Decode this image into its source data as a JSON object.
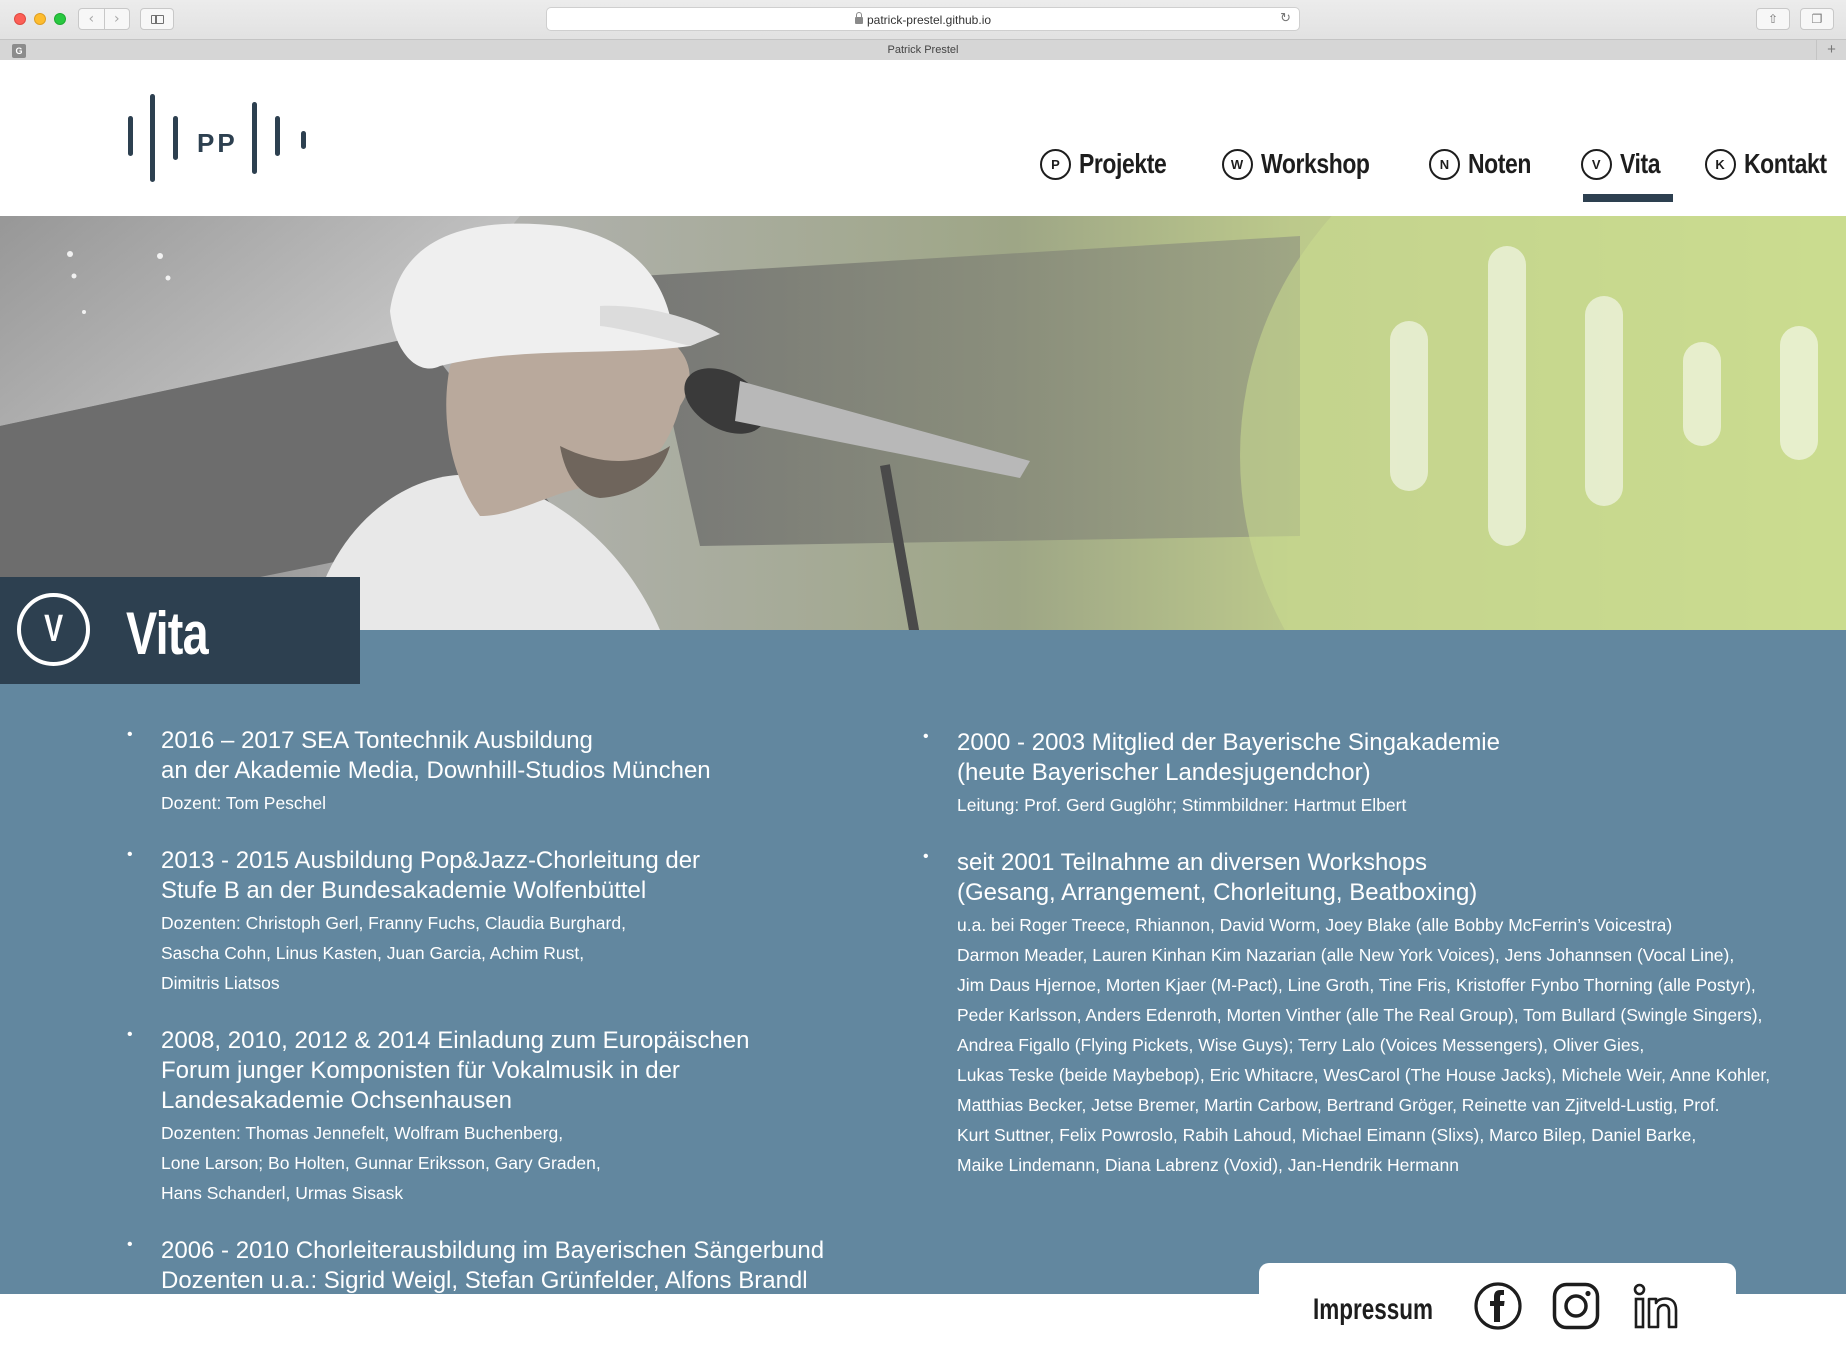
{
  "browser": {
    "url": "patrick-prestel.github.io",
    "tab_title": "Patrick Prestel",
    "tab_favicon_letter": "G"
  },
  "logo": {
    "letters": "PP"
  },
  "nav": {
    "items": [
      {
        "badge": "P",
        "label": "Projekte",
        "active": false
      },
      {
        "badge": "W",
        "label": "Workshop",
        "active": false
      },
      {
        "badge": "N",
        "label": "Noten",
        "active": false
      },
      {
        "badge": "V",
        "label": "Vita",
        "active": true
      },
      {
        "badge": "K",
        "label": "Kontakt",
        "active": false
      }
    ]
  },
  "section": {
    "badge": "V",
    "title": "Vita"
  },
  "vita": {
    "left": [
      {
        "title": "2016 – 2017 SEA Tontechnik Ausbildung\nan der Akademie Media, Downhill-Studios München",
        "detail": "Dozent: Tom Peschel"
      },
      {
        "title": "2013 - 2015 Ausbildung Pop&Jazz-Chorleitung der\nStufe B an der Bundesakademie Wolfenbüttel",
        "detail": "Dozenten: Christoph Gerl, Franny Fuchs, Claudia Burghard,\nSascha Cohn, Linus Kasten, Juan Garcia, Achim Rust,\nDimitris Liatsos"
      },
      {
        "title": "2008, 2010, 2012 & 2014 Einladung zum Europäischen\nForum junger Komponisten für Vokalmusik in der\nLandesakademie Ochsenhausen",
        "detail": "Dozenten: Thomas Jennefelt, Wolfram Buchenberg,\nLone Larson; Bo Holten, Gunnar Eriksson, Gary Graden,\nHans Schanderl, Urmas Sisask"
      },
      {
        "title": "2006 - 2010 Chorleiterausbildung im Bayerischen Sängerbund\nDozenten u.a.: Sigrid Weigl, Stefan Grünfelder, Alfons Brandl",
        "detail": ""
      }
    ],
    "right": [
      {
        "title": "2000 - 2003 Mitglied der Bayerische Singakademie\n(heute Bayerischer Landesjugendchor)",
        "detail": "Leitung: Prof. Gerd Guglöhr; Stimmbildner: Hartmut Elbert"
      },
      {
        "title": "seit 2001 Teilnahme an diversen Workshops\n(Gesang, Arrangement, Chorleitung, Beatboxing)",
        "detail": "u.a. bei Roger Treece, Rhiannon, David Worm, Joey Blake (alle Bobby McFerrin’s Voicestra)\nDarmon Meader, Lauren Kinhan Kim Nazarian (alle New York Voices), Jens Johannsen (Vocal Line),\nJim Daus Hjernoe, Morten Kjaer (M-Pact), Line Groth, Tine Fris, Kristoffer Fynbo Thorning (alle Postyr),\nPeder Karlsson, Anders Edenroth, Morten Vinther (alle The Real Group), Tom Bullard (Swingle Singers),\nAndrea Figallo (Flying Pickets, Wise Guys); Terry Lalo (Voices Messengers), Oliver Gies,\nLukas Teske (beide Maybebop), Eric Whitacre, WesCarol (The House Jacks), Michele Weir, Anne Kohler,\nMatthias Becker, Jetse Bremer, Martin Carbow, Bertrand Gröger, Reinette van Zjitveld-Lustig, Prof.\nKurt Suttner, Felix Powroslo, Rabih Lahoud, Michael Eimann (Slixs), Marco Bilep, Daniel Barke,\nMaike Lindemann, Diana Labrenz (Voxid), Jan-Hendrik Hermann"
      }
    ]
  },
  "footer": {
    "impressum": "Impressum",
    "social": [
      "facebook-icon",
      "instagram-icon",
      "linkedin-icon"
    ]
  },
  "colors": {
    "brand_dark": "#2d4050",
    "content_bg": "#62879f",
    "hero_green": "#cbdc8f"
  }
}
